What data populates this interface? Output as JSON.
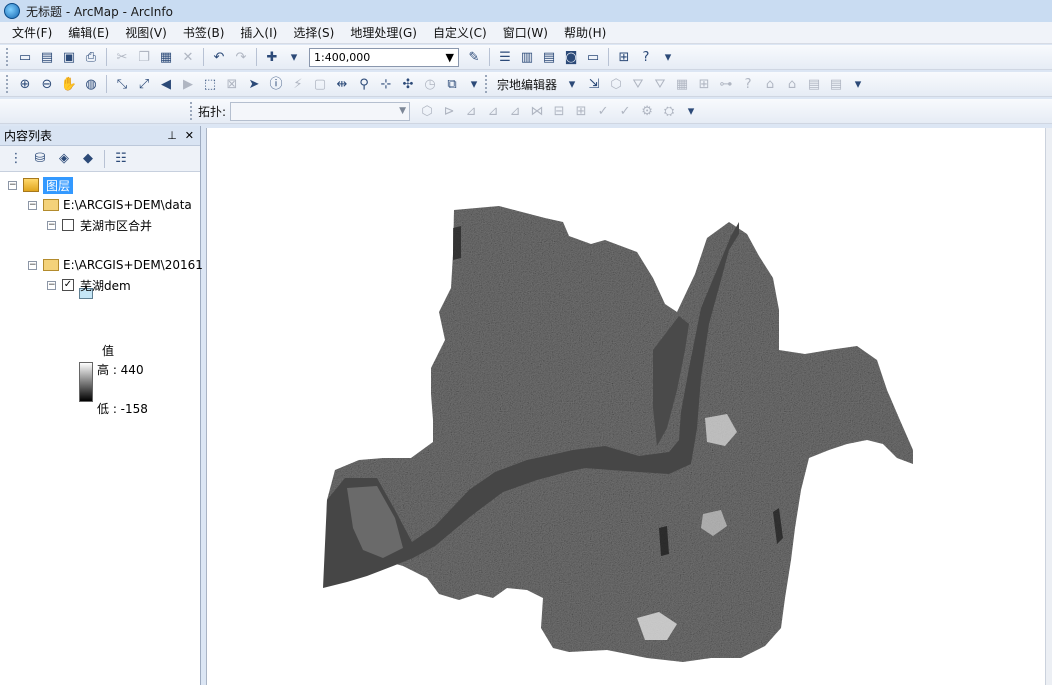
{
  "window": {
    "title": "无标题 - ArcMap - ArcInfo",
    "app_icon": "arcmap-globe-icon"
  },
  "menu": [
    "文件(F)",
    "编辑(E)",
    "视图(V)",
    "书签(B)",
    "插入(I)",
    "选择(S)",
    "地理处理(G)",
    "自定义(C)",
    "窗口(W)",
    "帮助(H)"
  ],
  "toolbar": {
    "scale": "1:400,000",
    "editor_label": "宗地编辑器",
    "topology_label": "拓扑:"
  },
  "toc": {
    "title": "内容列表",
    "root_label": "图层",
    "groups": [
      {
        "path": "E:\\ARCGIS+DEM\\data",
        "layer": "芜湖市区合并",
        "checked": false
      },
      {
        "path": "E:\\ARCGIS+DEM\\20161",
        "layer": "芜湖dem",
        "checked": true
      }
    ],
    "legend": {
      "title": "值",
      "high": "高 : 440",
      "low": "低 : -158"
    }
  },
  "colors": {
    "accent": "#3399ff",
    "polygon_fill": "#c6e6f6",
    "dem_mid": "#6c6c6c",
    "river": "#464646"
  }
}
